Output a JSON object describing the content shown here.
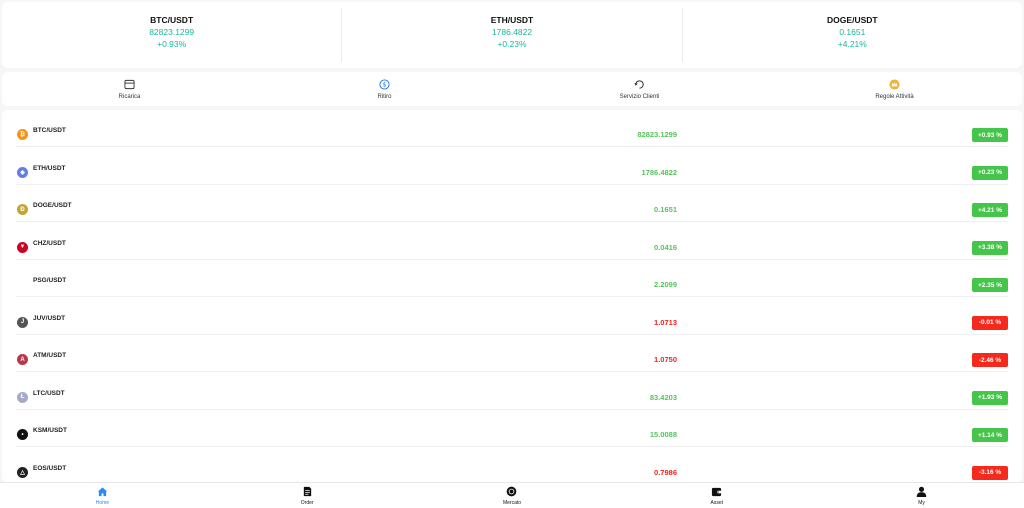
{
  "tickers": [
    {
      "pair": "BTC/USDT",
      "price": "82823.1299",
      "change": "+0.93%"
    },
    {
      "pair": "ETH/USDT",
      "price": "1786.4822",
      "change": "+0.23%"
    },
    {
      "pair": "DOGE/USDT",
      "price": "0.1651",
      "change": "+4.21%"
    }
  ],
  "quick_actions": [
    {
      "label": "Ricarica",
      "icon": "wallet-icon"
    },
    {
      "label": "Ritiro",
      "icon": "withdraw-icon"
    },
    {
      "label": "Servizio Clienti",
      "icon": "customer-service-icon"
    },
    {
      "label": "Regole Attività",
      "icon": "crown-icon"
    }
  ],
  "market": [
    {
      "pair": "BTC/USDT",
      "price": "82823.1299",
      "change": "+0.93 %",
      "trend": "up",
      "icon_color": "#f7931a",
      "icon_glyph": "₿"
    },
    {
      "pair": "ETH/USDT",
      "price": "1786.4822",
      "change": "+0.23 %",
      "trend": "up",
      "icon_color": "#627eea",
      "icon_glyph": "◆"
    },
    {
      "pair": "DOGE/USDT",
      "price": "0.1651",
      "change": "+4.21 %",
      "trend": "up",
      "icon_color": "#c2a633",
      "icon_glyph": "Ð"
    },
    {
      "pair": "CHZ/USDT",
      "price": "0.0416",
      "change": "+3.38 %",
      "trend": "up",
      "icon_color": "#cd0124",
      "icon_glyph": "▼"
    },
    {
      "pair": "PSG/USDT",
      "price": "2.2099",
      "change": "+2.35 %",
      "trend": "up",
      "icon_color": "",
      "icon_glyph": ""
    },
    {
      "pair": "JUV/USDT",
      "price": "1.0713",
      "change": "-0.01 %",
      "trend": "down",
      "icon_color": "#555555",
      "icon_glyph": "J"
    },
    {
      "pair": "ATM/USDT",
      "price": "1.0750",
      "change": "-2.46 %",
      "trend": "down",
      "icon_color": "#b6394a",
      "icon_glyph": "A"
    },
    {
      "pair": "LTC/USDT",
      "price": "83.4203",
      "change": "+1.93 %",
      "trend": "up",
      "icon_color": "#a6a9c9",
      "icon_glyph": "Ł"
    },
    {
      "pair": "KSM/USDT",
      "price": "15.0088",
      "change": "+1.14 %",
      "trend": "up",
      "icon_color": "#111111",
      "icon_glyph": "•"
    },
    {
      "pair": "EOS/USDT",
      "price": "0.7986",
      "change": "-3.16 %",
      "trend": "down",
      "icon_color": "#222222",
      "icon_glyph": "△"
    }
  ],
  "tabbar": [
    {
      "label": "Home",
      "icon": "home-icon",
      "active": true
    },
    {
      "label": "Order",
      "icon": "order-icon",
      "active": false
    },
    {
      "label": "Mercato",
      "icon": "market-icon",
      "active": false
    },
    {
      "label": "Asset",
      "icon": "asset-wallet-icon",
      "active": false
    },
    {
      "label": "My",
      "icon": "user-icon",
      "active": false
    }
  ],
  "colors": {
    "accent": "#2a8bf2",
    "up": "#56c35a",
    "down": "#f0221b",
    "ticker_green": "#16b89a"
  }
}
